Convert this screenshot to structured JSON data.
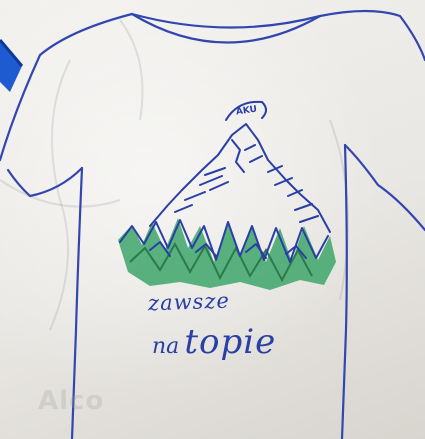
{
  "photo": {
    "subject": "",
    "ink_color": "#2a3fa6",
    "accent_color": "#3da66a",
    "marker_color": "#1f5bd0"
  },
  "texts": {
    "line1": "zawsze",
    "line2_small": "na",
    "line2_large": "topie",
    "summit_label": "AKU",
    "ghost_watermark": "Alco"
  }
}
